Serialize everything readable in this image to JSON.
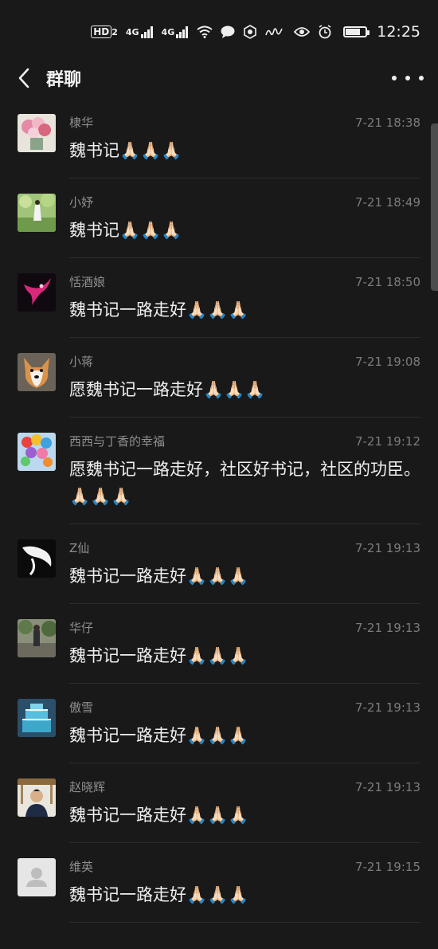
{
  "status_bar": {
    "hd": "HD",
    "hd_sub": "2",
    "net1": "4G",
    "net2": "4G",
    "time": "12:25"
  },
  "header": {
    "title": "群聊"
  },
  "messages": [
    {
      "name": "棣华",
      "time": "7-21 18:38",
      "text": "魏书记🙏🏻🙏🏻🙏🏻"
    },
    {
      "name": "小妤",
      "time": "7-21 18:49",
      "text": "魏书记🙏🏻🙏🏻🙏🏻"
    },
    {
      "name": "恬酒娘",
      "time": "7-21 18:50",
      "text": "魏书记一路走好🙏🏻🙏🏻🙏🏻"
    },
    {
      "name": "小蒋",
      "time": "7-21 19:08",
      "text": "愿魏书记一路走好🙏🏻🙏🏻🙏🏻"
    },
    {
      "name": "西西与丁香的幸福",
      "time": "7-21 19:12",
      "text": "愿魏书记一路走好，社区好书记，社区的功臣。🙏🏻🙏🏻🙏🏻"
    },
    {
      "name": "Z仙",
      "time": "7-21 19:13",
      "text": "魏书记一路走好🙏🏻🙏🏻🙏🏻"
    },
    {
      "name": "华仔",
      "time": "7-21 19:13",
      "text": "魏书记一路走好🙏🏻🙏🏻🙏🏻"
    },
    {
      "name": "傲雪",
      "time": "7-21 19:13",
      "text": "魏书记一路走好🙏🏻🙏🏻🙏🏻"
    },
    {
      "name": "赵晓辉",
      "time": "7-21 19:13",
      "text": "魏书记一路走好🙏🏻🙏🏻🙏🏻"
    },
    {
      "name": "维英",
      "time": "7-21 19:15",
      "text": "魏书记一路走好🙏🏻🙏🏻🙏🏻"
    }
  ]
}
